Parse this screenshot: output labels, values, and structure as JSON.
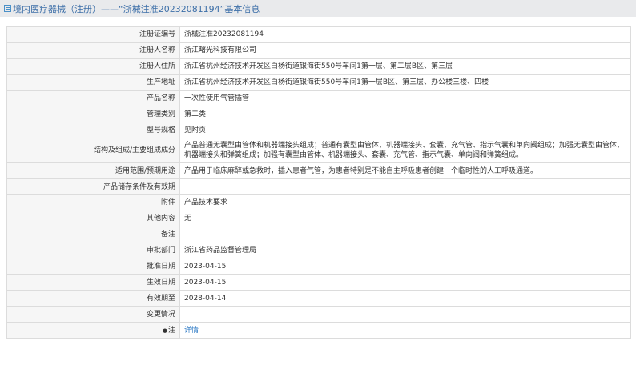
{
  "header": {
    "title": "境内医疗器械（注册）——“浙械注准20232081194”基本信息"
  },
  "rows": [
    {
      "label": "注册证编号",
      "value": "浙械注准20232081194"
    },
    {
      "label": "注册人名称",
      "value": "浙江曙光科技有限公司"
    },
    {
      "label": "注册人住所",
      "value": "浙江省杭州经济技术开发区白杨街道银海街550号车间1第一层、第二层B区、第三层"
    },
    {
      "label": "生产地址",
      "value": "浙江省杭州经济技术开发区白杨街道银海街550号车间1第一层B区、第三层、办公楼三楼、四楼"
    },
    {
      "label": "产品名称",
      "value": "一次性使用气管插管"
    },
    {
      "label": "管理类别",
      "value": "第二类"
    },
    {
      "label": "型号规格",
      "value": "见附页"
    },
    {
      "label": "结构及组成/主要组成成分",
      "value": "产品普通无囊型由管体和机器端接头组成；普通有囊型由管体、机器端接头、套囊、充气管、指示气囊和单向阀组成；加强无囊型由管体、机器端接头和弹簧组成；加强有囊型由管体、机器端接头、套囊、充气管、指示气囊、单向阀和弹簧组成。"
    },
    {
      "label": "适用范围/预期用途",
      "value": "产品用于临床麻醉或急救时，插入患者气管，为患者特别是不能自主呼吸患者创建一个临时性的人工呼吸通道。"
    },
    {
      "label": "产品储存条件及有效期",
      "value": ""
    },
    {
      "label": "附件",
      "value": "产品技术要求"
    },
    {
      "label": "其他内容",
      "value": "无"
    },
    {
      "label": "备注",
      "value": ""
    },
    {
      "label": "审批部门",
      "value": "浙江省药品监督管理局"
    },
    {
      "label": "批准日期",
      "value": "2023-04-15"
    },
    {
      "label": "生效日期",
      "value": "2023-04-15"
    },
    {
      "label": "有效期至",
      "value": "2028-04-14"
    },
    {
      "label": "变更情况",
      "value": ""
    }
  ],
  "note_row": {
    "label": "注",
    "link": "详情",
    "icon": "pin-icon"
  }
}
